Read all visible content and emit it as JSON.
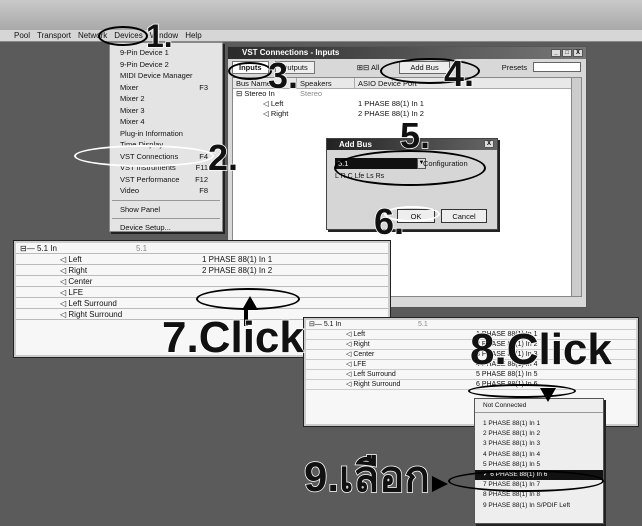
{
  "menubar": [
    "Pool",
    "Transport",
    "Network",
    "Devices",
    "Window",
    "Help"
  ],
  "devices_menu": [
    {
      "label": "9-Pin Device 1",
      "shortcut": ""
    },
    {
      "label": "9-Pin Device 2",
      "shortcut": ""
    },
    {
      "label": "MIDI Device Manager",
      "shortcut": ""
    },
    {
      "label": "Mixer",
      "shortcut": "F3"
    },
    {
      "label": "Mixer 2",
      "shortcut": ""
    },
    {
      "label": "Mixer 3",
      "shortcut": ""
    },
    {
      "label": "Mixer 4",
      "shortcut": ""
    },
    {
      "label": "Plug-in Information",
      "shortcut": ""
    },
    {
      "label": "Time Display",
      "shortcut": ""
    },
    {
      "label": "VST Connections",
      "shortcut": "F4"
    },
    {
      "label": "VST Instruments",
      "shortcut": "F11"
    },
    {
      "label": "VST Performance",
      "shortcut": "F12"
    },
    {
      "label": "Video",
      "shortcut": "F8"
    },
    {
      "label": "Show Panel",
      "shortcut": ""
    },
    {
      "label": "Device Setup...",
      "shortcut": ""
    }
  ],
  "vst_window": {
    "title": "VST Connections - Inputs",
    "tab_inputs": "Inputs",
    "tab_outputs": "Outputs",
    "all_label": "All",
    "add_bus": "Add Bus",
    "presets": "Presets",
    "columns": [
      "Bus Name",
      "Speakers",
      "ASIO Device Port"
    ],
    "rows": [
      {
        "name": "Stereo In",
        "speakers": "Stereo",
        "port": ""
      },
      {
        "name": "Left",
        "speakers": "",
        "port": "1 PHASE 88(1) In 1"
      },
      {
        "name": "Right",
        "speakers": "",
        "port": "2 PHASE 88(1) In 2"
      }
    ],
    "win_buttons": [
      "_",
      "□",
      "X"
    ]
  },
  "add_bus_dialog": {
    "title": "Add Bus",
    "config_value": "5.1",
    "config_label": "Configuration",
    "speakers": "L R C Lfe Ls Rs",
    "ok": "OK",
    "cancel": "Cancel",
    "close": "X"
  },
  "zoom1": {
    "bus": "5.1 In",
    "bus_speakers": "5.1",
    "channels": [
      {
        "name": "Left",
        "port": "1 PHASE 88(1) In 1"
      },
      {
        "name": "Right",
        "port": "2 PHASE 88(1) In 2"
      },
      {
        "name": "Center",
        "port": ""
      },
      {
        "name": "LFE",
        "port": ""
      },
      {
        "name": "Left Surround",
        "port": ""
      },
      {
        "name": "Right Surround",
        "port": ""
      }
    ]
  },
  "zoom2": {
    "bus": "5.1 In",
    "bus_speakers": "5.1",
    "channels": [
      {
        "name": "Left",
        "port": "1 PHASE 88(1) In 1"
      },
      {
        "name": "Right",
        "port": "2 PHASE 88(1) In 2"
      },
      {
        "name": "Center",
        "port": "3 PHASE 88(1) In 3"
      },
      {
        "name": "LFE",
        "port": "4 PHASE 88(1) In 4"
      },
      {
        "name": "Left Surround",
        "port": "5 PHASE 88(1) In 5"
      },
      {
        "name": "Right Surround",
        "port": "6 PHASE 88(1) In 6"
      }
    ]
  },
  "port_list": [
    "Not Connected",
    "1 PHASE 88(1) In 1",
    "2 PHASE 88(1) In 2",
    "3 PHASE 88(1) In 3",
    "4 PHASE 88(1) In 4",
    "5 PHASE 88(1) In 5",
    "6 PHASE 88(1) In 6",
    "7 PHASE 88(1) In 7",
    "8 PHASE 88(1) In 8",
    "9 PHASE 88(1) In S/PDIF Left"
  ],
  "selected_port": "6 PHASE 88(1) In 6",
  "steps": {
    "s1": "1.",
    "s2": "2.",
    "s3": "3.",
    "s4": "4.",
    "s5": "5.",
    "s6": "6.",
    "s7": "7.Click",
    "s8": "8.Click",
    "s9": "9.เลือก"
  }
}
